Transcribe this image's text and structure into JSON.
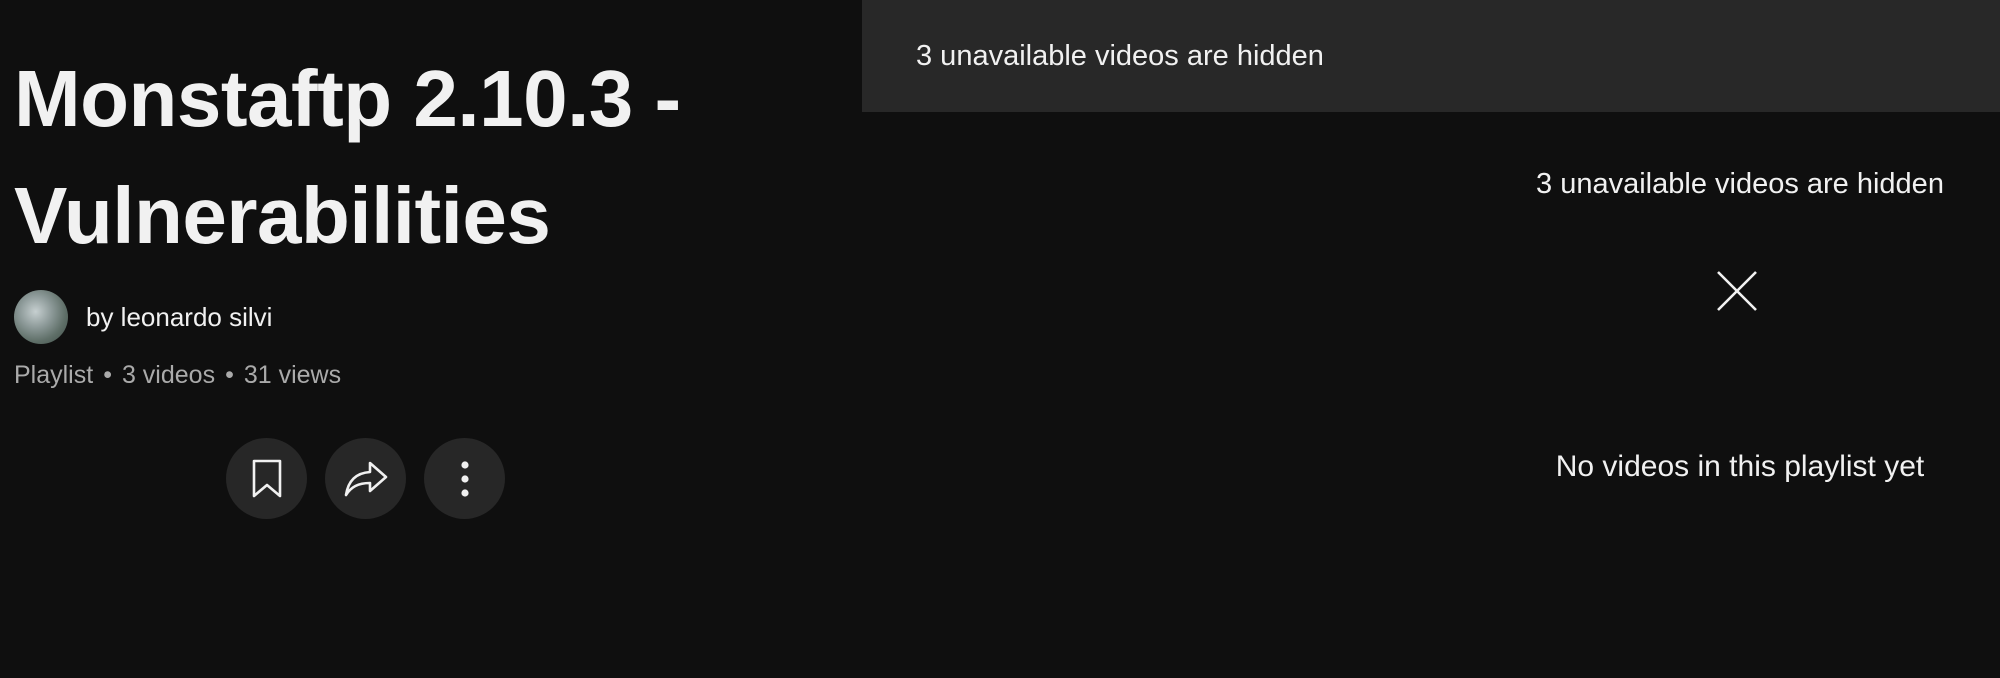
{
  "playlist": {
    "title": "Monstaftp 2.10.3 - Vulnerabilities",
    "owner": "by leonardo silvi",
    "type": "Playlist",
    "video_count": "3 videos",
    "views": "31 views",
    "separator": "•"
  },
  "actions": {
    "save_icon": "bookmark-icon",
    "share_icon": "share-icon",
    "more_icon": "more-vert-icon"
  },
  "banner": {
    "text": "3 unavailable videos are hidden"
  },
  "content": {
    "hidden_text": "3 unavailable videos are hidden",
    "close_icon": "close-icon",
    "empty_text": "No videos in this playlist yet"
  },
  "colors": {
    "background": "#0f0f0f",
    "banner": "#282828",
    "button": "#272727",
    "text_primary": "#f1f1f1",
    "text_secondary": "#aaaaaa"
  }
}
